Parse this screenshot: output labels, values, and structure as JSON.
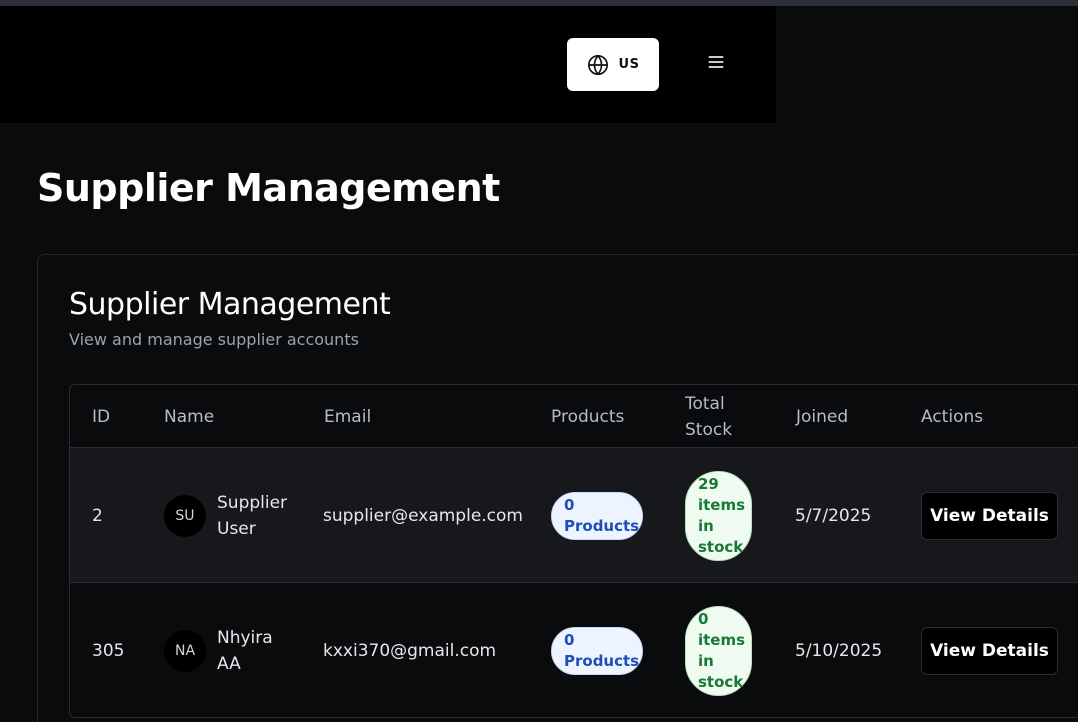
{
  "header": {
    "language_code": "US",
    "globe_icon": "globe-icon",
    "menu_icon": "hamburger-menu-icon"
  },
  "page": {
    "title": "Supplier Management"
  },
  "card": {
    "title": "Supplier Management",
    "subtitle": "View and manage supplier accounts"
  },
  "table": {
    "columns": {
      "id": "ID",
      "name": "Name",
      "email": "Email",
      "products": "Products",
      "total_stock": "Total Stock",
      "joined": "Joined",
      "actions": "Actions"
    },
    "rows": [
      {
        "id": "2",
        "initials": "SU",
        "name": "Supplier User",
        "email": "supplier@example.com",
        "products": "0 Products",
        "stock": "29 items in stock",
        "joined": "5/7/2025",
        "action": "View Details"
      },
      {
        "id": "305",
        "initials": "NA",
        "name": "Nhyira AA",
        "email": "kxxi370@gmail.com",
        "products": "0 Products",
        "stock": "0 items in stock",
        "joined": "5/10/2025",
        "action": "View Details"
      }
    ]
  },
  "colors": {
    "background": "#0a0b0d",
    "header": "#000000",
    "products_badge_text": "#1d4fb8",
    "stock_badge_text": "#177a36"
  }
}
